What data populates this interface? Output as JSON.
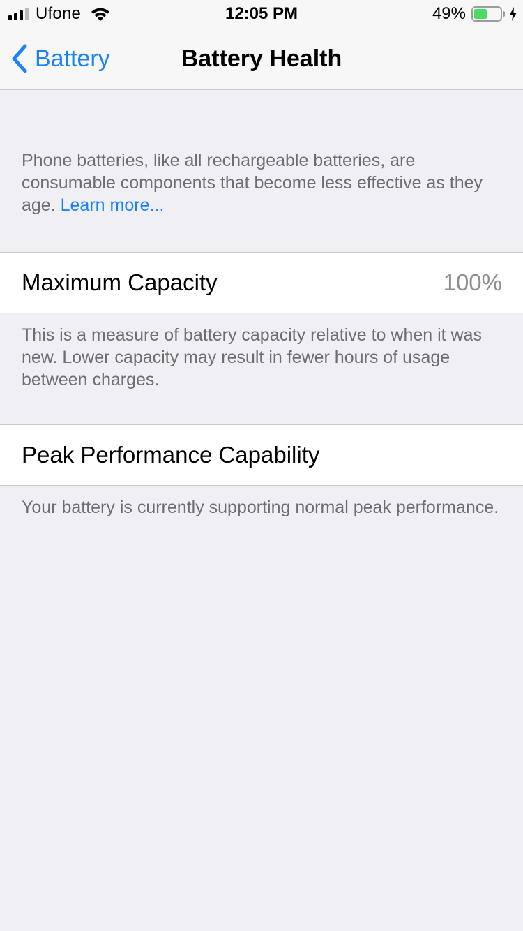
{
  "status_bar": {
    "carrier": "Ufone",
    "time": "12:05 PM",
    "battery_percent": "49%",
    "battery_level": 0.49,
    "signal_bars": 4,
    "signal_bars_active": 3,
    "battery_fill_color": "#4cd964",
    "icons": [
      "signal-icon",
      "wifi-icon",
      "battery-icon",
      "charging-bolt-icon"
    ]
  },
  "nav": {
    "back_label": "Battery",
    "back_icon": "chevron-left-icon",
    "title": "Battery Health",
    "accent_color": "#1a82fb"
  },
  "intro": {
    "text": "Phone batteries, like all rechargeable batteries, are consumable components that become less effective as they age.",
    "link": "Learn more..."
  },
  "maximum_capacity": {
    "label": "Maximum Capacity",
    "value": "100%",
    "footer": "This is a measure of battery capacity relative to when it was new. Lower capacity may result in fewer hours of usage between charges."
  },
  "peak_performance": {
    "label": "Peak Performance Capability",
    "footer": "Your battery is currently supporting normal peak performance."
  }
}
